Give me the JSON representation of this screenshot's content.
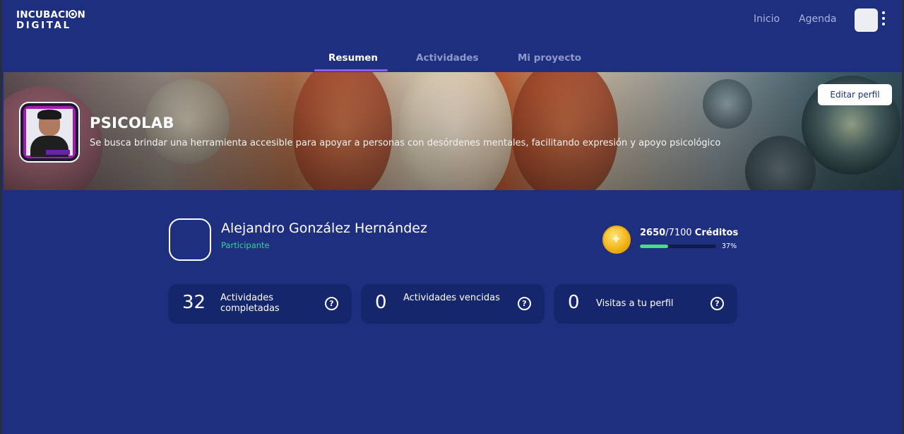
{
  "brand": {
    "line1": "INCUBACI",
    "line1_end": "N",
    "line2": "DIGITAL"
  },
  "nav": {
    "home": "Inicio",
    "agenda": "Agenda"
  },
  "tabs": [
    {
      "label": "Resumen",
      "active": true
    },
    {
      "label": "Actividades",
      "active": false
    },
    {
      "label": "Mi proyecto",
      "active": false
    }
  ],
  "project": {
    "title": "PSICOLAB",
    "description": "Se busca brindar una herramienta accesible para apoyar a personas con desórdenes mentales, facilitando expresión y apoyo psicológico",
    "edit_label": "Editar perfil"
  },
  "user": {
    "name": "Alejandro González Hernández",
    "role": "Participante"
  },
  "credits": {
    "current": "2650",
    "total": "/7100",
    "label": "Créditos",
    "percent_label": "37%",
    "percent": 0.37
  },
  "stats": [
    {
      "value": "32",
      "label": "Actividades completadas"
    },
    {
      "value": "0",
      "label": "Actividades vencidas"
    },
    {
      "value": "0",
      "label": "Visitas a tu perfil"
    }
  ],
  "help_glyph": "?",
  "colors": {
    "background": "#1e2f80",
    "accent": "#8b5cf6",
    "role": "#34d399",
    "progress": "#4ade80",
    "card": "#16266d"
  }
}
